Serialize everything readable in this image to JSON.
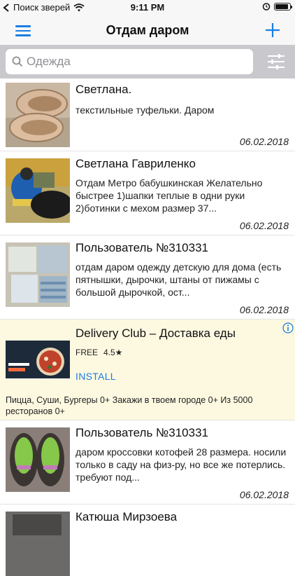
{
  "status_bar": {
    "carrier": "Поиск зверей",
    "time": "9:11 PM"
  },
  "nav": {
    "title": "Отдам даром",
    "menu_icon": "hamburger-icon",
    "add_icon": "plus-icon"
  },
  "search": {
    "placeholder": "Одежда",
    "value": "",
    "filter_icon": "sliders-icon"
  },
  "items": [
    {
      "title": "Светлана.",
      "description": "текстильные туфельки. Даром",
      "date": "06.02.2018"
    },
    {
      "title": "Светлана Гавриленко",
      "description": "Отдам Метро бабушкинская Желательно быстрее 1)шапки теплые в одни руки 2)ботинки с мехом размер 37...",
      "date": "06.02.2018"
    },
    {
      "title": "Пользователь №310331",
      "description": "отдам даром одежду детскую для дома (есть пятнышки, дырочки, штаны от пижамы с большой дырочкой, ост...",
      "date": "06.02.2018"
    },
    {
      "title": "Пользователь №310331",
      "description": "даром кроссовки котофей 28 размера. носили только в саду на физ-ру, но все же потерлись. требуют под...",
      "date": "06.02.2018"
    },
    {
      "title": "Катюша Мирзоева",
      "description": "",
      "date": ""
    }
  ],
  "ad": {
    "title": "Delivery Club – Доставка еды",
    "price": "FREE",
    "rating": "4.5★",
    "install_label": "INSTALL",
    "body": "Пицца, Суши, Бургеры 0+ Закажи в твоем городе 0+ Из 5000 ресторанов 0+",
    "banner_text": "Ударенные ЛЕГКИЙ заказ еды!",
    "info_icon": "info-icon"
  },
  "colors": {
    "accent": "#1a7ee3",
    "ad_background": "#fdf9e1",
    "search_bar_background": "#c9c9cd"
  }
}
